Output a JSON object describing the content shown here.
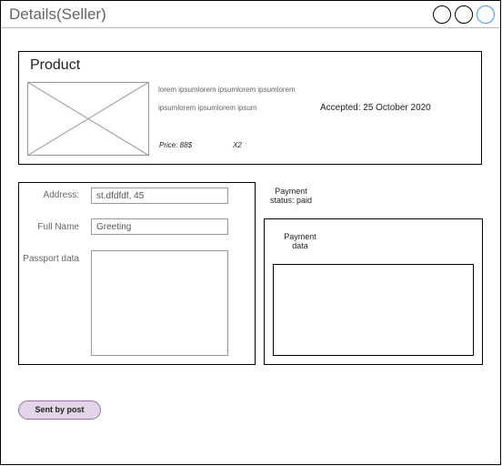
{
  "window": {
    "title": "Details(Seller)"
  },
  "product": {
    "heading": "Product",
    "desc_line1": "lorem ipsumlorem ipsumlorem ipsumlorem",
    "desc_line2": "ipsumlorem ipsumlorem ipsum",
    "accepted": "Accepted: 25 October 2020",
    "price": "Price: 88$",
    "quantity": "X2"
  },
  "form": {
    "address_label": "Address:",
    "address_value": "st.dfdfdf, 45",
    "fullname_label": "Full Name",
    "fullname_value": "Greeting",
    "passport_label": "Passport data"
  },
  "payment": {
    "status": "Payment\nstatus: paid",
    "data_label": "Payment\ndata"
  },
  "actions": {
    "sent_by_post": "Sent by post"
  },
  "colors": {
    "button_fill": "#e1d5e7",
    "button_border": "#9673a6",
    "accent_circle": "#3399ff"
  }
}
